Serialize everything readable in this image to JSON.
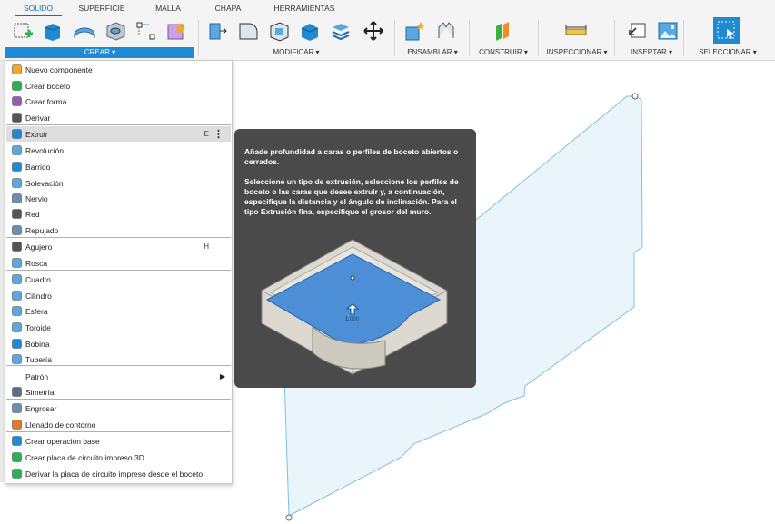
{
  "tabs": [
    {
      "label": "SOLIDO",
      "active": true
    },
    {
      "label": "SUPERFICIE",
      "active": false
    },
    {
      "label": "MALLA",
      "active": false
    },
    {
      "label": "CHAPA",
      "active": false
    },
    {
      "label": "HERRAMIENTAS",
      "active": false
    }
  ],
  "groups": {
    "crear": "CREAR ▾",
    "modificar": "MODIFICAR ▾",
    "ensamblar": "ENSAMBLAR ▾",
    "construir": "CONSTRUIR ▾",
    "inspeccionar": "INSPECCIONAR ▾",
    "insertar": "INSERTAR ▾",
    "seleccionar": "SELECCIONAR ▾"
  },
  "menu": {
    "items": [
      {
        "label": "Nuevo componente",
        "icon": "new-component-icon"
      },
      {
        "label": "Crear boceto",
        "icon": "create-sketch-icon"
      },
      {
        "label": "Crear forma",
        "icon": "create-form-icon"
      },
      {
        "label": "Derivar",
        "icon": "derive-icon"
      },
      {
        "label": "Extruir",
        "icon": "extrude-icon",
        "shortcut": "E",
        "highlighted": true,
        "more": "⋮"
      },
      {
        "label": "Revolución",
        "icon": "revolve-icon"
      },
      {
        "label": "Barrido",
        "icon": "sweep-icon"
      },
      {
        "label": "Solevación",
        "icon": "loft-icon"
      },
      {
        "label": "Nervio",
        "icon": "rib-icon"
      },
      {
        "label": "Red",
        "icon": "web-icon"
      },
      {
        "label": "Repujado",
        "icon": "emboss-icon"
      },
      {
        "label": "Agujero",
        "icon": "hole-icon",
        "shortcut": "H"
      },
      {
        "label": "Rosca",
        "icon": "thread-icon"
      },
      {
        "label": "Cuadro",
        "icon": "box-icon"
      },
      {
        "label": "Cilindro",
        "icon": "cylinder-icon"
      },
      {
        "label": "Esfera",
        "icon": "sphere-icon"
      },
      {
        "label": "Toroide",
        "icon": "torus-icon"
      },
      {
        "label": "Bobina",
        "icon": "coil-icon"
      },
      {
        "label": "Tubería",
        "icon": "pipe-icon"
      },
      {
        "label": "Patrón",
        "icon": "",
        "submenu": "▶"
      },
      {
        "label": "Simetría",
        "icon": "mirror-icon"
      },
      {
        "label": "Engrosar",
        "icon": "thicken-icon"
      },
      {
        "label": "Llenado de contorno",
        "icon": "boundary-fill-icon"
      },
      {
        "label": "Crear operación base",
        "icon": "base-feature-icon"
      },
      {
        "label": "Crear placa de circuito impreso 3D",
        "icon": "pcb-icon"
      },
      {
        "label": "Derivar la placa de circuito impreso desde el boceto",
        "icon": "pcb-derive-icon"
      }
    ]
  },
  "tooltip": {
    "para1": "Añade profundidad a caras o perfiles de boceto abiertos o cerrados.",
    "para2": "Seleccione un tipo de extrusión, seleccione los perfiles de boceto o las caras que desee extruir y, a continuación, especifique la distancia y el ángulo de inclinación. Para el tipo Extrusión fina, especifique el grosor del muro.",
    "dim_label": "1.000"
  },
  "colors": {
    "accent": "#1f8ad1",
    "sketch_plane": "#7fc0e2",
    "tooltip_bg": "#4a4a4a",
    "highlight": "#dedede"
  }
}
